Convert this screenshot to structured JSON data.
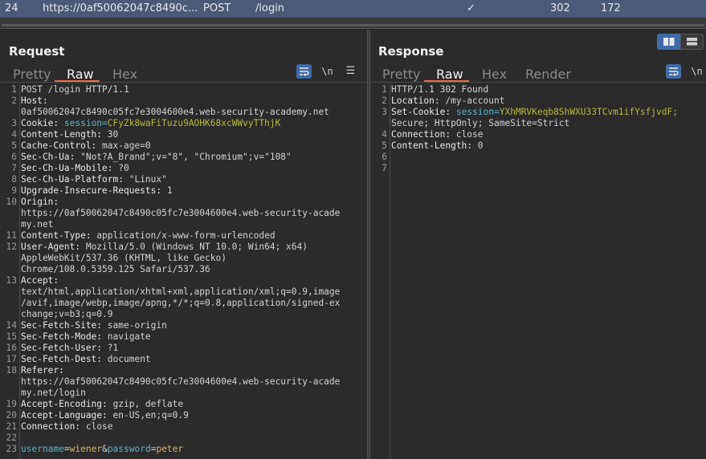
{
  "history": {
    "id": "24",
    "url": "https://0af50062047c8490c...",
    "method": "POST",
    "path": "/login",
    "check": "✓",
    "status": "302",
    "length": "172"
  },
  "request": {
    "title": "Request",
    "tabs": [
      "Pretty",
      "Raw",
      "Hex"
    ],
    "active_tab": "Raw",
    "wrap_icon": "wrap-lines-icon",
    "newline_label": "\\n",
    "menu_icon": "☰",
    "lines": [
      {
        "n": "1",
        "segments": [
          {
            "t": "POST /login HTTP/1.1",
            "c": "v"
          }
        ]
      },
      {
        "n": "2",
        "segments": [
          {
            "t": "Host:",
            "c": "k"
          }
        ]
      },
      {
        "n": "",
        "segments": [
          {
            "t": "0af50062047c8490c05fc7e3004600e4.web-security-academy.net",
            "c": "v"
          }
        ]
      },
      {
        "n": "3",
        "segments": [
          {
            "t": "Cookie: ",
            "c": "k"
          },
          {
            "t": "session=",
            "c": "param-n"
          },
          {
            "t": "CFyZk8waFiTuzu9AOHK68xcWWvyTThjK",
            "c": "cookie-v"
          }
        ]
      },
      {
        "n": "4",
        "segments": [
          {
            "t": "Content-Length: ",
            "c": "k"
          },
          {
            "t": "30",
            "c": "v"
          }
        ]
      },
      {
        "n": "5",
        "segments": [
          {
            "t": "Cache-Control: ",
            "c": "k"
          },
          {
            "t": "max-age=0",
            "c": "v"
          }
        ]
      },
      {
        "n": "6",
        "segments": [
          {
            "t": "Sec-Ch-Ua: ",
            "c": "k"
          },
          {
            "t": "\"Not?A_Brand\";v=\"8\", \"Chromium\";v=\"108\"",
            "c": "v"
          }
        ]
      },
      {
        "n": "7",
        "segments": [
          {
            "t": "Sec-Ch-Ua-Mobile: ",
            "c": "k"
          },
          {
            "t": "?0",
            "c": "v"
          }
        ]
      },
      {
        "n": "8",
        "segments": [
          {
            "t": "Sec-Ch-Ua-Platform: ",
            "c": "k"
          },
          {
            "t": "\"Linux\"",
            "c": "v"
          }
        ]
      },
      {
        "n": "9",
        "segments": [
          {
            "t": "Upgrade-Insecure-Requests: ",
            "c": "k"
          },
          {
            "t": "1",
            "c": "v"
          }
        ]
      },
      {
        "n": "10",
        "segments": [
          {
            "t": "Origin:",
            "c": "k"
          }
        ]
      },
      {
        "n": "",
        "segments": [
          {
            "t": "https://0af50062047c8490c05fc7e3004600e4.web-security-acade",
            "c": "v"
          }
        ]
      },
      {
        "n": "",
        "segments": [
          {
            "t": "my.net",
            "c": "v"
          }
        ]
      },
      {
        "n": "11",
        "segments": [
          {
            "t": "Content-Type: ",
            "c": "k"
          },
          {
            "t": "application/x-www-form-urlencoded",
            "c": "v"
          }
        ]
      },
      {
        "n": "12",
        "segments": [
          {
            "t": "User-Agent: ",
            "c": "k"
          },
          {
            "t": "Mozilla/5.0 (Windows NT 10.0; Win64; x64)",
            "c": "v"
          }
        ]
      },
      {
        "n": "",
        "segments": [
          {
            "t": "AppleWebKit/537.36 (KHTML, like Gecko)",
            "c": "v"
          }
        ]
      },
      {
        "n": "",
        "segments": [
          {
            "t": "Chrome/108.0.5359.125 Safari/537.36",
            "c": "v"
          }
        ]
      },
      {
        "n": "13",
        "segments": [
          {
            "t": "Accept:",
            "c": "k"
          }
        ]
      },
      {
        "n": "",
        "segments": [
          {
            "t": "text/html,application/xhtml+xml,application/xml;q=0.9,image",
            "c": "v"
          }
        ]
      },
      {
        "n": "",
        "segments": [
          {
            "t": "/avif,image/webp,image/apng,*/*;q=0.8,application/signed-ex",
            "c": "v"
          }
        ]
      },
      {
        "n": "",
        "segments": [
          {
            "t": "change;v=b3;q=0.9",
            "c": "v"
          }
        ]
      },
      {
        "n": "14",
        "segments": [
          {
            "t": "Sec-Fetch-Site: ",
            "c": "k"
          },
          {
            "t": "same-origin",
            "c": "v"
          }
        ]
      },
      {
        "n": "15",
        "segments": [
          {
            "t": "Sec-Fetch-Mode: ",
            "c": "k"
          },
          {
            "t": "navigate",
            "c": "v"
          }
        ]
      },
      {
        "n": "16",
        "segments": [
          {
            "t": "Sec-Fetch-User: ",
            "c": "k"
          },
          {
            "t": "?1",
            "c": "v"
          }
        ]
      },
      {
        "n": "17",
        "segments": [
          {
            "t": "Sec-Fetch-Dest: ",
            "c": "k"
          },
          {
            "t": "document",
            "c": "v"
          }
        ]
      },
      {
        "n": "18",
        "segments": [
          {
            "t": "Referer:",
            "c": "k"
          }
        ]
      },
      {
        "n": "",
        "segments": [
          {
            "t": "https://0af50062047c8490c05fc7e3004600e4.web-security-acade",
            "c": "v"
          }
        ]
      },
      {
        "n": "",
        "segments": [
          {
            "t": "my.net/login",
            "c": "v"
          }
        ]
      },
      {
        "n": "19",
        "segments": [
          {
            "t": "Accept-Encoding: ",
            "c": "k"
          },
          {
            "t": "gzip, deflate",
            "c": "v"
          }
        ]
      },
      {
        "n": "20",
        "segments": [
          {
            "t": "Accept-Language: ",
            "c": "k"
          },
          {
            "t": "en-US,en;q=0.9",
            "c": "v"
          }
        ]
      },
      {
        "n": "21",
        "segments": [
          {
            "t": "Connection: ",
            "c": "k"
          },
          {
            "t": "close",
            "c": "v"
          }
        ]
      },
      {
        "n": "22",
        "segments": []
      },
      {
        "n": "23",
        "segments": [
          {
            "t": "username",
            "c": "param-n"
          },
          {
            "t": "=",
            "c": "v"
          },
          {
            "t": "wiener",
            "c": "param-v"
          },
          {
            "t": "&",
            "c": "v"
          },
          {
            "t": "password",
            "c": "param-n"
          },
          {
            "t": "=",
            "c": "v"
          },
          {
            "t": "peter",
            "c": "param-v"
          }
        ]
      }
    ]
  },
  "response": {
    "title": "Response",
    "tabs": [
      "Pretty",
      "Raw",
      "Hex",
      "Render"
    ],
    "active_tab": "Raw",
    "newline_label": "\\n",
    "lines": [
      {
        "n": "1",
        "segments": [
          {
            "t": "HTTP/1.1 302 Found",
            "c": "v"
          }
        ]
      },
      {
        "n": "2",
        "segments": [
          {
            "t": "Location: ",
            "c": "k"
          },
          {
            "t": "/my-account",
            "c": "v"
          }
        ]
      },
      {
        "n": "3",
        "segments": [
          {
            "t": "Set-Cookie: ",
            "c": "k"
          },
          {
            "t": "session=",
            "c": "param-n"
          },
          {
            "t": "YXhMRVKeqb8ShWXU33TCvm1ifYsfjvdF;",
            "c": "cookie-v"
          }
        ]
      },
      {
        "n": "",
        "segments": [
          {
            "t": "Secure; HttpOnly; SameSite=Strict",
            "c": "v"
          }
        ]
      },
      {
        "n": "4",
        "segments": [
          {
            "t": "Connection: ",
            "c": "k"
          },
          {
            "t": "close",
            "c": "v"
          }
        ]
      },
      {
        "n": "5",
        "segments": [
          {
            "t": "Content-Length: ",
            "c": "k"
          },
          {
            "t": "0",
            "c": "v"
          }
        ]
      },
      {
        "n": "6",
        "segments": []
      },
      {
        "n": "7",
        "segments": []
      }
    ]
  },
  "colors": {
    "accent_underline": "#e8704b",
    "selected_row": "#4a5a78",
    "button_blue": "#3f6aa8"
  }
}
